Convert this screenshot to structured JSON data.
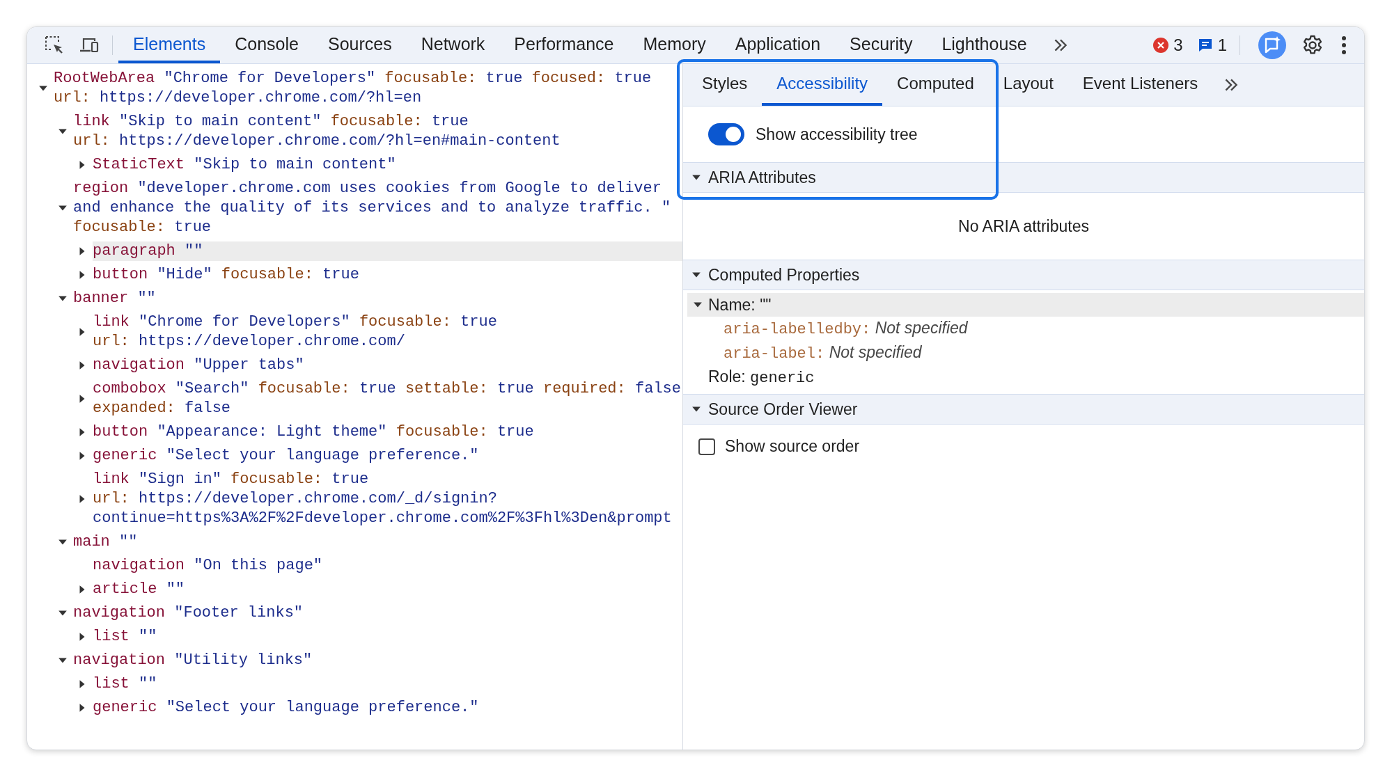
{
  "toolbar": {
    "tabs": [
      {
        "label": "Elements",
        "selected": true
      },
      {
        "label": "Console",
        "selected": false
      },
      {
        "label": "Sources",
        "selected": false
      },
      {
        "label": "Network",
        "selected": false
      },
      {
        "label": "Performance",
        "selected": false
      },
      {
        "label": "Memory",
        "selected": false
      },
      {
        "label": "Application",
        "selected": false
      },
      {
        "label": "Security",
        "selected": false
      },
      {
        "label": "Lighthouse",
        "selected": false
      }
    ],
    "errors": "3",
    "messages": "1"
  },
  "tree": [
    {
      "role": "RootWebArea",
      "name": "\"Chrome for Developers\"",
      "expanded": true,
      "selected": false,
      "props": [
        {
          "key": "focusable:",
          "value": "true",
          "kind": "inline"
        },
        {
          "key": "focused:",
          "value": "true",
          "kind": "inline"
        },
        {
          "key": "url:",
          "value": "https://developer.chrome.com/?hl=en",
          "kind": "line"
        }
      ],
      "children": [
        {
          "role": "link",
          "name": "\"Skip to main content\"",
          "expanded": true,
          "selected": false,
          "props": [
            {
              "key": "focusable:",
              "value": "true",
              "kind": "inline"
            },
            {
              "key": "url:",
              "value": "https://developer.chrome.com/?hl=en#main-content",
              "kind": "line"
            }
          ],
          "children": [
            {
              "role": "StaticText",
              "name": "\"Skip to main content\"",
              "expanded": false,
              "selected": false
            }
          ]
        },
        {
          "role": "region",
          "name": "\"developer.chrome.com uses cookies from Google to deliver and enhance the quality of its services and to analyze traffic. \"",
          "expanded": true,
          "selected": false,
          "props": [
            {
              "key": "focusable:",
              "value": "true",
              "kind": "line"
            }
          ],
          "children": [
            {
              "role": "paragraph",
              "name": "\"\"",
              "expanded": false,
              "selected": true
            },
            {
              "role": "button",
              "name": "\"Hide\"",
              "expanded": false,
              "selected": false,
              "props": [
                {
                  "key": "focusable:",
                  "value": "true",
                  "kind": "inline"
                }
              ]
            }
          ]
        },
        {
          "role": "banner",
          "name": "\"\"",
          "expanded": true,
          "selected": false,
          "children": [
            {
              "role": "link",
              "name": "\"Chrome for Developers\"",
              "expanded": false,
              "selected": false,
              "props": [
                {
                  "key": "focusable:",
                  "value": "true",
                  "kind": "inline"
                },
                {
                  "key": "url:",
                  "value": "https://developer.chrome.com/",
                  "kind": "line"
                }
              ]
            },
            {
              "role": "navigation",
              "name": "\"Upper tabs\"",
              "expanded": false,
              "selected": false
            },
            {
              "role": "combobox",
              "name": "\"Search\"",
              "expanded": false,
              "selected": false,
              "props": [
                {
                  "key": "focusable:",
                  "value": "true",
                  "kind": "inline"
                },
                {
                  "key": "settable:",
                  "value": "true",
                  "kind": "inline"
                },
                {
                  "key": "required:",
                  "value": "false",
                  "kind": "inline"
                },
                {
                  "key": "expanded:",
                  "value": "false",
                  "kind": "line"
                }
              ]
            },
            {
              "role": "button",
              "name": "\"Appearance: Light theme\"",
              "expanded": false,
              "selected": false,
              "props": [
                {
                  "key": "focusable:",
                  "value": "true",
                  "kind": "inline"
                }
              ]
            },
            {
              "role": "generic",
              "name": "\"Select your language preference.\"",
              "expanded": false,
              "selected": false
            },
            {
              "role": "link",
              "name": "\"Sign in\"",
              "expanded": false,
              "selected": false,
              "props": [
                {
                  "key": "focusable:",
                  "value": "true",
                  "kind": "inline"
                },
                {
                  "key": "url:",
                  "value": "https://developer.chrome.com/_d/signin?continue=https%3A%2F%2Fdeveloper.chrome.com%2F%3Fhl%3Den&prompt",
                  "kind": "line"
                }
              ]
            }
          ]
        },
        {
          "role": "main",
          "name": "\"\"",
          "expanded": true,
          "selected": false,
          "children": [
            {
              "role": "navigation",
              "name": "\"On this page\"",
              "selected": false
            },
            {
              "role": "article",
              "name": "\"\"",
              "expanded": false,
              "selected": false
            }
          ]
        },
        {
          "role": "navigation",
          "name": "\"Footer links\"",
          "expanded": true,
          "selected": false,
          "children": [
            {
              "role": "list",
              "name": "\"\"",
              "expanded": false,
              "selected": false
            }
          ]
        },
        {
          "role": "navigation",
          "name": "\"Utility links\"",
          "expanded": true,
          "selected": false,
          "children": [
            {
              "role": "list",
              "name": "\"\"",
              "expanded": false,
              "selected": false
            },
            {
              "role": "generic",
              "name": "\"Select your language preference.\"",
              "expanded": false,
              "selected": false
            }
          ]
        }
      ]
    }
  ],
  "side_tabs": [
    {
      "label": "Styles",
      "selected": false
    },
    {
      "label": "Accessibility",
      "selected": true
    },
    {
      "label": "Computed",
      "selected": false
    },
    {
      "label": "Layout",
      "selected": false
    },
    {
      "label": "Event Listeners",
      "selected": false
    }
  ],
  "a11y_toggle": {
    "label": "Show accessibility tree",
    "on": true
  },
  "sections": [
    {
      "kind": "empty",
      "title": "ARIA Attributes",
      "expanded": true,
      "message": "No ARIA attributes"
    },
    {
      "kind": "properties",
      "title": "Computed Properties",
      "expanded": true,
      "name_row": {
        "label": "Name:",
        "value": "\"\"",
        "expanded": true
      },
      "sources": [
        {
          "key": "aria-labelledby:",
          "value": "Not specified"
        },
        {
          "key": "aria-label:",
          "value": "Not specified"
        }
      ],
      "role_row": {
        "label": "Role:",
        "value": "generic"
      }
    },
    {
      "kind": "checkbox",
      "title": "Source Order Viewer",
      "expanded": true,
      "checkbox": {
        "label": "Show source order",
        "checked": false
      }
    }
  ]
}
